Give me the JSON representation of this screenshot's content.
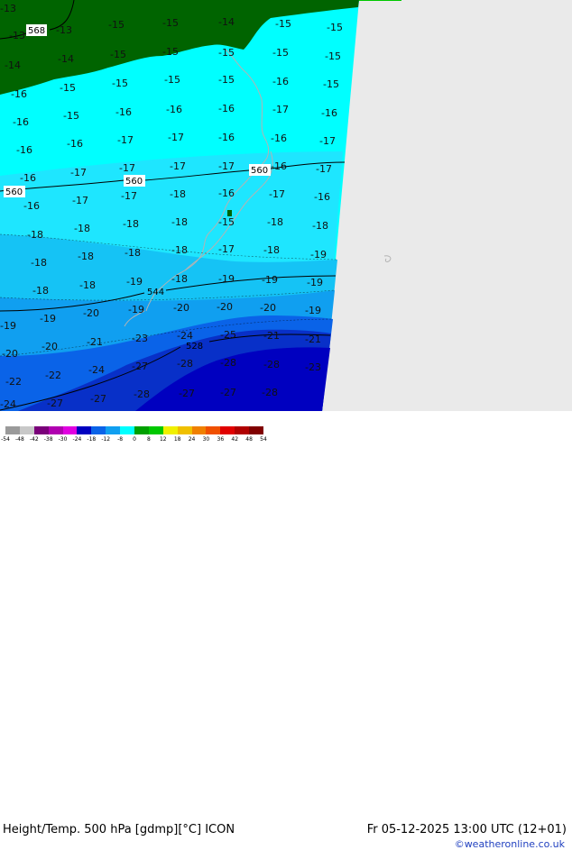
{
  "map": {
    "title": "Height/Temp. 500 hPa [gdmp][°C] ICON",
    "datetime": "Fr 05-12-2025 13:00 UTC (12+01)",
    "copyright": "©weatheronline.co.uk",
    "colors": {
      "band_m13": "#006400",
      "band_m16": "#00ffff",
      "band_m17": "#1ee6ff",
      "band_m19": "#15c3f5",
      "band_m20": "#109ff0",
      "band_m22": "#0a63e8",
      "band_m24": "#0830c8",
      "band_m26": "#0000c0",
      "coast": "#b3b3b3",
      "no_data": "#eaeaea",
      "contour": "#000000"
    },
    "height_labels": [
      "568",
      "560",
      "560",
      "560",
      "544",
      "528"
    ],
    "temperature_labels": [
      "-13",
      "-13",
      "-13",
      "-15",
      "-15",
      "-14",
      "-15",
      "-15",
      "-14",
      "-14",
      "-15",
      "-15",
      "-15",
      "-15",
      "-15",
      "-16",
      "-15",
      "-15",
      "-15",
      "-15",
      "-16",
      "-15",
      "-16",
      "-15",
      "-16",
      "-16",
      "-16",
      "-17",
      "-16",
      "-16",
      "-16",
      "-17",
      "-17",
      "-16",
      "-16",
      "-17",
      "-16",
      "-17",
      "-17",
      "-17",
      "-17",
      "-16",
      "-17",
      "-16",
      "-17",
      "-17",
      "-18",
      "-16",
      "-17",
      "-16",
      "-18",
      "-18",
      "-18",
      "-18",
      "-15",
      "-18",
      "-18",
      "-18",
      "-18",
      "-18",
      "-18",
      "-17",
      "-18",
      "-19",
      "-18",
      "-18",
      "-19",
      "-18",
      "-19",
      "-19",
      "-19",
      "-19",
      "-19",
      "-20",
      "-19",
      "-20",
      "-20",
      "-20",
      "-19",
      "-20",
      "-20",
      "-21",
      "-23",
      "-24",
      "-25",
      "-21",
      "-21",
      "-22",
      "-22",
      "-24",
      "-27",
      "-28",
      "-28",
      "-28",
      "-23",
      "-24",
      "-27",
      "-27",
      "-28",
      "-27",
      "-27",
      "-28"
    ],
    "legend": {
      "ticks": [
        "-54",
        "-48",
        "-42",
        "-38",
        "-30",
        "-24",
        "-18",
        "-12",
        "-8",
        "0",
        "8",
        "12",
        "18",
        "24",
        "30",
        "36",
        "42",
        "48",
        "54"
      ],
      "colors": [
        "#9a9a9a",
        "#c8c8c8",
        "#7a007a",
        "#b000b0",
        "#e000e0",
        "#0000c0",
        "#0a63e8",
        "#109ff0",
        "#00ffff",
        "#00a000",
        "#00c800",
        "#f0f000",
        "#f0c000",
        "#f08000",
        "#f05000",
        "#e00000",
        "#b00000",
        "#800000"
      ]
    }
  }
}
